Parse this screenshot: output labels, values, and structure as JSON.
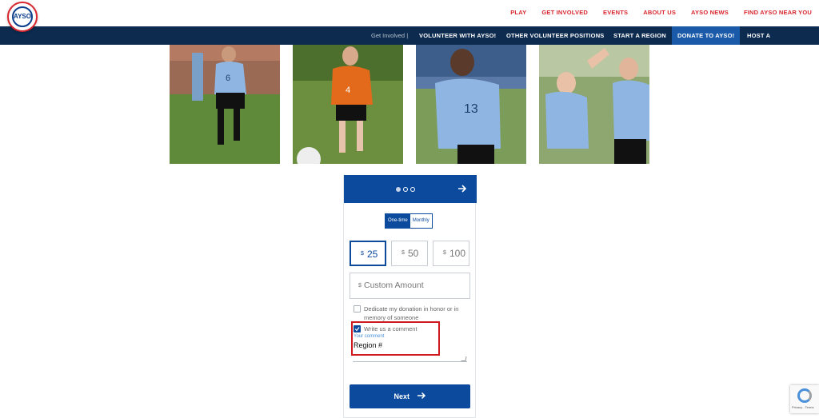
{
  "brand": {
    "logo_text": "AYSO"
  },
  "top_nav": [
    "PLAY",
    "GET INVOLVED",
    "EVENTS",
    "ABOUT US",
    "AYSO NEWS",
    "FIND AYSO NEAR YOU"
  ],
  "sub_nav": {
    "lead": "Get Involved |",
    "items": [
      "VOLUNTEER WITH AYSO!",
      "OTHER VOLUNTEER POSITIONS",
      "START A REGION",
      "DONATE TO AYSO!",
      "HOST A TOURNAMENT"
    ],
    "active_index": 3
  },
  "photos": [
    {
      "name": "boy-player-jersey-6",
      "jersey_number": "6"
    },
    {
      "name": "girl-player-orange-jersey",
      "jersey_number": "4"
    },
    {
      "name": "girl-player-jersey-13",
      "jersey_number": "13"
    },
    {
      "name": "girls-high-five",
      "jersey_number": ""
    }
  ],
  "donation_form": {
    "step_indicator": {
      "total": 3,
      "current": 1
    },
    "frequency": {
      "one_time": "One-time",
      "monthly": "Monthly",
      "selected": "One-time"
    },
    "currency_symbol": "$",
    "amounts": [
      "25",
      "50",
      "100"
    ],
    "selected_amount": "25",
    "custom_amount_placeholder": "Custom Amount",
    "honor_label_line1": "Dedicate my donation in honor or in",
    "honor_label_line2": "memory of someone",
    "honor_checked": false,
    "comment_checkbox_label": "Write us a comment",
    "comment_checked": true,
    "comment_field_label": "Your comment",
    "comment_value": "Region #",
    "next_label": "Next"
  },
  "recaptcha": {
    "footer": "Privacy - Terms"
  },
  "colors": {
    "brand_red": "#d9262e",
    "nav_navy": "#0c2b4f",
    "primary_blue": "#0b4a9c",
    "highlight_red": "#d0191f"
  }
}
